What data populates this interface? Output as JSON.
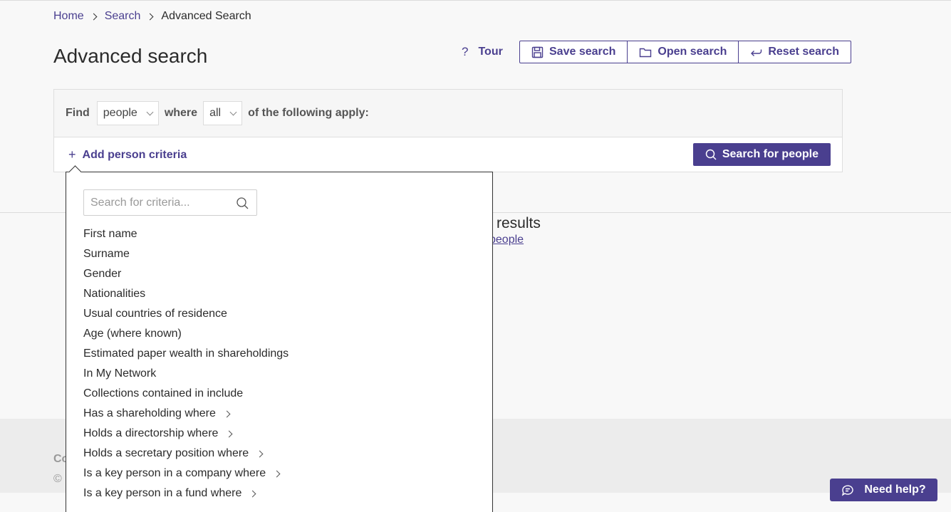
{
  "breadcrumb": {
    "items": [
      "Home",
      "Search"
    ],
    "current": "Advanced Search"
  },
  "page": {
    "title": "Advanced search"
  },
  "toolbar": {
    "tour_label": "Tour",
    "save_label": "Save search",
    "open_label": "Open search",
    "reset_label": "Reset search"
  },
  "query": {
    "find_label": "Find",
    "entity_value": "people",
    "where_label": "where",
    "match_value": "all",
    "suffix": "of the following apply:"
  },
  "criteria": {
    "add_label": "Add person criteria",
    "search_button": "Search for people"
  },
  "dropdown": {
    "search_placeholder": "Search for criteria...",
    "items": [
      {
        "label": "First name",
        "has_sub": false
      },
      {
        "label": "Surname",
        "has_sub": false
      },
      {
        "label": "Gender",
        "has_sub": false
      },
      {
        "label": "Nationalities",
        "has_sub": false
      },
      {
        "label": "Usual countries of residence",
        "has_sub": false
      },
      {
        "label": "Age (where known)",
        "has_sub": false
      },
      {
        "label": "Estimated paper wealth in shareholdings",
        "has_sub": false
      },
      {
        "label": "In My Network",
        "has_sub": false
      },
      {
        "label": "Collections contained in include",
        "has_sub": false
      },
      {
        "label": "Has a shareholding where",
        "has_sub": true
      },
      {
        "label": "Holds a directorship where",
        "has_sub": true
      },
      {
        "label": "Holds a secretary position where",
        "has_sub": true
      },
      {
        "label": "Is a key person in a company where",
        "has_sub": true
      },
      {
        "label": "Is a key person in a fund where",
        "has_sub": true
      }
    ]
  },
  "results": {
    "title": "results",
    "link": "people"
  },
  "footer": {
    "line1": "Co",
    "line2": "©"
  },
  "help": {
    "label": "Need help?"
  },
  "colors": {
    "accent": "#4a3f8f"
  }
}
